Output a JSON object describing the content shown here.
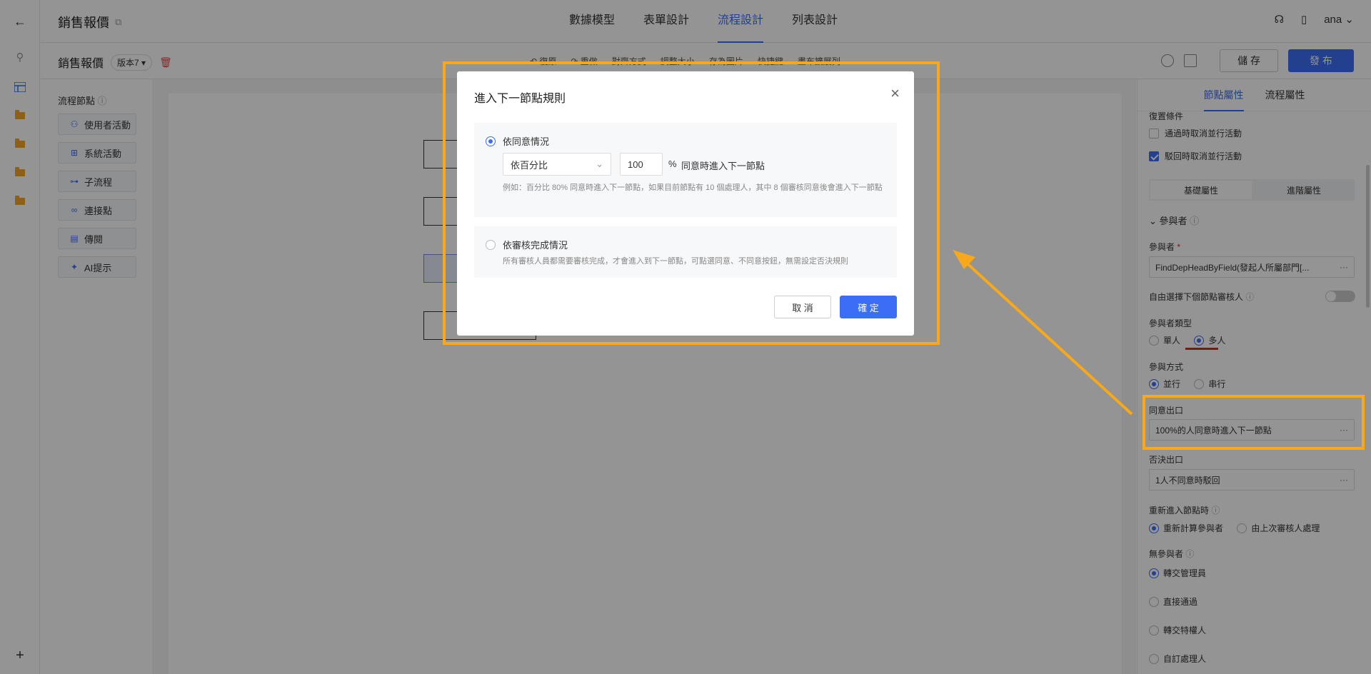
{
  "header": {
    "title": "銷售報價",
    "tabs": [
      "數據模型",
      "表單設計",
      "流程設計",
      "列表設計"
    ],
    "active_tab": "流程設計",
    "user": "ana"
  },
  "subbar": {
    "title": "銷售報價",
    "version": "版本7 ▾",
    "tools": [
      "↶ 復原",
      "↷ 重做",
      "對齊方式",
      "調整大小",
      "存為圖片",
      "快捷鍵",
      "畫布擴展列"
    ],
    "save_label": "儲 存",
    "publish_label": "發 布"
  },
  "node_panel": {
    "title": "流程節點",
    "items": [
      {
        "label": "使用者活動",
        "icon": "user-icon"
      },
      {
        "label": "系統活動",
        "icon": "grid-icon"
      },
      {
        "label": "子流程",
        "icon": "subflow-icon"
      },
      {
        "label": "連接點",
        "icon": "link-icon"
      },
      {
        "label": "傳閱",
        "icon": "document-icon"
      },
      {
        "label": "AI提示",
        "icon": "ai-icon"
      }
    ]
  },
  "props": {
    "tabs": [
      "節點屬性",
      "流程屬性"
    ],
    "active_tab": "節點屬性",
    "reset_label": "復置條件",
    "cancel_parallel_pass": "通過時取消並行活動",
    "cancel_parallel_reject": "駁回時取消並行活動",
    "seg_basic": "基礎屬性",
    "seg_advanced": "進階屬性",
    "participants_section": "參與者",
    "participant_label": "參與者",
    "participant_value": "FindDepHeadByField(發起人所屬部門[...",
    "free_select_label": "自由選擇下個節點審核人",
    "type_label": "參與者類型",
    "type_single": "單人",
    "type_multi": "多人",
    "mode_label": "參與方式",
    "mode_parallel": "並行",
    "mode_serial": "串行",
    "agree_exit_label": "同意出口",
    "agree_exit_value": "100%的人同意時進入下一節點",
    "reject_exit_label": "否決出口",
    "reject_exit_value": "1人不同意時駁回",
    "reenter_label": "重新進入節點時",
    "reenter_opt1": "重新計算參與者",
    "reenter_opt2": "由上次審核人處理",
    "no_participant_label": "無參與者",
    "np_opt1": "轉交管理員",
    "np_opt2": "直接通過",
    "np_opt3": "轉交特權人",
    "np_opt4": "自訂處理人"
  },
  "modal": {
    "title": "進入下一節點規則",
    "option1_label": "依同意情況",
    "select_value": "依百分比",
    "percent_value": "100",
    "percent_sign": "%",
    "percent_text": "同意時進入下一節點",
    "option1_hint": "例如：百分比 80% 同意時進入下一節點，如果目前節點有 10 個處理人，其中 8 個審核同意後會進入下一節點",
    "option2_label": "依審核完成情況",
    "option2_hint": "所有審核人員都需要審核完成，才會進入到下一節點，可點選同意、不同意按鈕，無需設定否決規則",
    "cancel_label": "取 消",
    "confirm_label": "確 定"
  },
  "colors": {
    "accent": "#3b6ef5",
    "annotation": "#f7a81b",
    "underline": "#e02424"
  }
}
